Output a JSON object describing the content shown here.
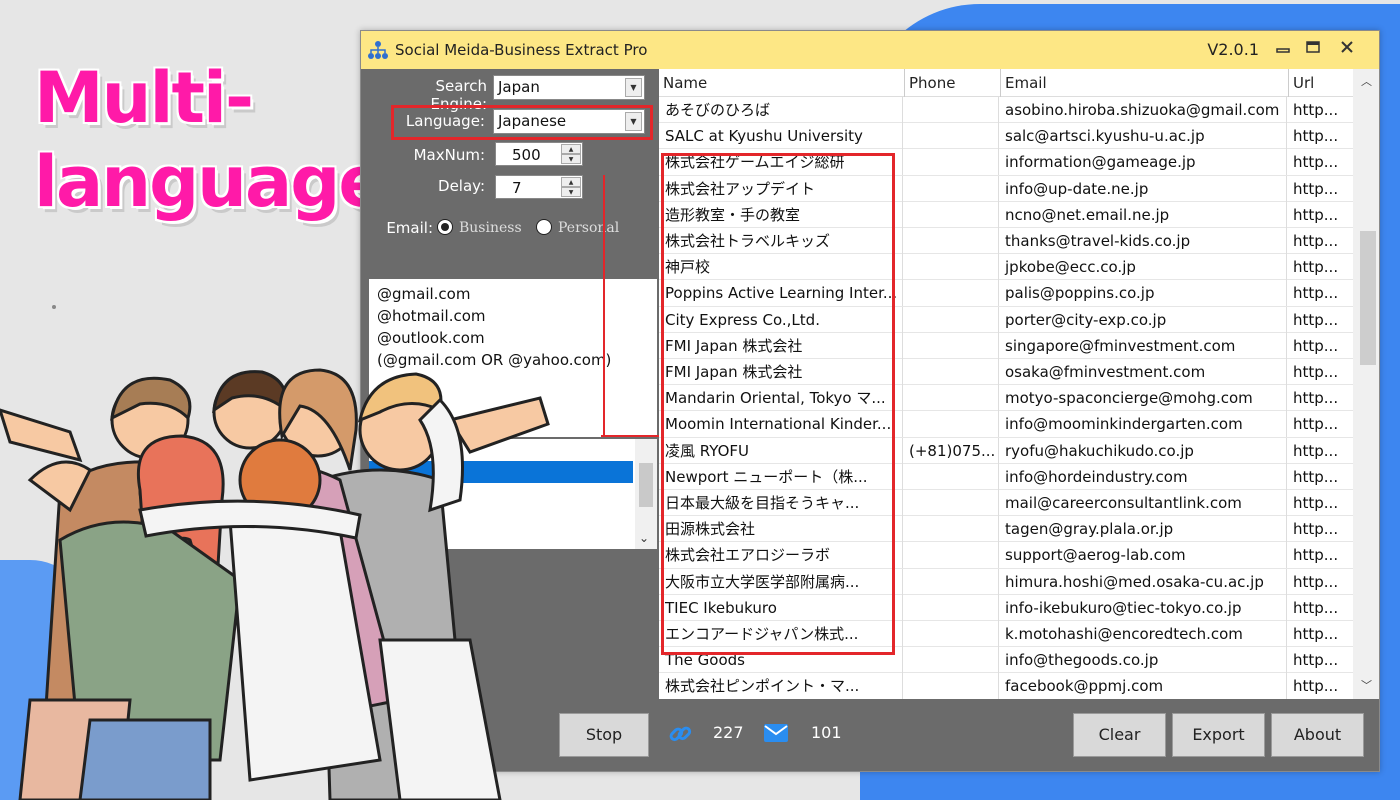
{
  "promo": {
    "line1": "Multi-",
    "line2": "language"
  },
  "app": {
    "title": "Social Meida-Business Extract Pro",
    "version": "V2.0.1"
  },
  "settings": {
    "search_engine_label": "Search Engine:",
    "search_engine_value": "Japan",
    "language_label": "Language:",
    "language_value": "Japanese",
    "maxnum_label": "MaxNum:",
    "maxnum_value": "500",
    "delay_label": "Delay:",
    "delay_value": "7",
    "email_label": "Email:",
    "email_type_business": "Business",
    "email_type_personal": "Personal",
    "email_type_selected": "Business",
    "email_domains": [
      "@gmail.com",
      "@hotmail.com",
      "@outlook.com",
      "(@gmail.com OR @yahoo.com)"
    ]
  },
  "table": {
    "columns": [
      "Name",
      "Phone",
      "Email",
      "Url"
    ],
    "rows": [
      {
        "name": "あそびのひろば",
        "phone": "",
        "email": "asobino.hiroba.shizuoka@gmail.com",
        "url": "http..."
      },
      {
        "name": "SALC at Kyushu University",
        "phone": "",
        "email": "salc@artsci.kyushu-u.ac.jp",
        "url": "http..."
      },
      {
        "name": "株式会社ゲームエイジ総研",
        "phone": "",
        "email": "information@gameage.jp",
        "url": "http..."
      },
      {
        "name": "株式会社アップデイト",
        "phone": "",
        "email": "info@up-date.ne.jp",
        "url": "http..."
      },
      {
        "name": "造形教室・手の教室",
        "phone": "",
        "email": "ncno@net.email.ne.jp",
        "url": "http..."
      },
      {
        "name": "株式会社トラベルキッズ",
        "phone": "",
        "email": "thanks@travel-kids.co.jp",
        "url": "http..."
      },
      {
        "name": "神戸校",
        "phone": "",
        "email": "jpkobe@ecc.co.jp",
        "url": "http..."
      },
      {
        "name": "Poppins Active Learning Inter...",
        "phone": "",
        "email": "palis@poppins.co.jp",
        "url": "http..."
      },
      {
        "name": "City Express Co.,Ltd.",
        "phone": "",
        "email": "porter@city-exp.co.jp",
        "url": "http..."
      },
      {
        "name": "FMI Japan 株式会社",
        "phone": "",
        "email": "singapore@fminvestment.com",
        "url": "http..."
      },
      {
        "name": "FMI Japan 株式会社",
        "phone": "",
        "email": "osaka@fminvestment.com",
        "url": "http..."
      },
      {
        "name": "Mandarin Oriental, Tokyo マ...",
        "phone": "",
        "email": "motyo-spaconcierge@mohg.com",
        "url": "http..."
      },
      {
        "name": "Moomin International Kinder...",
        "phone": "",
        "email": "info@moominkindergarten.com",
        "url": "http..."
      },
      {
        "name": "凌風 RYOFU",
        "phone": "(+81)075...",
        "email": "ryofu@hakuchikudo.co.jp",
        "url": "http..."
      },
      {
        "name": "Newport ニューポート（株...",
        "phone": "",
        "email": "info@hordeindustry.com",
        "url": "http..."
      },
      {
        "name": "日本最大級を目指そうキャ...",
        "phone": "",
        "email": "mail@careerconsultantlink.com",
        "url": "http..."
      },
      {
        "name": "田源株式会社",
        "phone": "",
        "email": "tagen@gray.plala.or.jp",
        "url": "http..."
      },
      {
        "name": "株式会社エアロジーラボ",
        "phone": "",
        "email": "support@aerog-lab.com",
        "url": "http..."
      },
      {
        "name": "大阪市立大学医学部附属病...",
        "phone": "",
        "email": "himura.hoshi@med.osaka-cu.ac.jp",
        "url": "http..."
      },
      {
        "name": "TIEC Ikebukuro",
        "phone": "",
        "email": "info-ikebukuro@tiec-tokyo.co.jp",
        "url": "http..."
      },
      {
        "name": "エンコアードジャパン株式...",
        "phone": "",
        "email": "k.motohashi@encoredtech.com",
        "url": "http..."
      },
      {
        "name": "The Goods",
        "phone": "",
        "email": "info@thegoods.co.jp",
        "url": "http..."
      },
      {
        "name": "株式会社ピンポイント・マ...",
        "phone": "",
        "email": "facebook@ppmj.com",
        "url": "http..."
      }
    ]
  },
  "toolbar": {
    "stop_label": "Stop",
    "links_count": "227",
    "emails_count": "101",
    "clear_label": "Clear",
    "export_label": "Export",
    "about_label": "About"
  },
  "colors": {
    "title_bar": "#fde785",
    "panel": "#6b6b6b",
    "highlight": "#e3262a",
    "promo_text": "#ff1aa8",
    "selection": "#0a74d8",
    "background_accent": "#3d86f0"
  },
  "icons": [
    "app-network-icon",
    "minimize-icon",
    "maximize-icon",
    "close-icon",
    "link-icon",
    "mail-icon",
    "dropdown-arrow-icon",
    "spin-up-icon",
    "spin-down-icon"
  ]
}
